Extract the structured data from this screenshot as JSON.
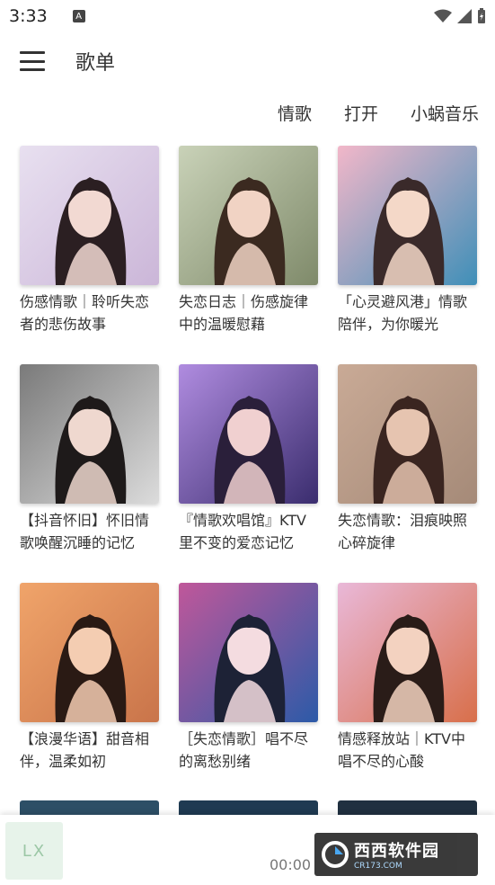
{
  "status_bar": {
    "time": "3:33",
    "notification_icon": "a-icon"
  },
  "app_bar": {
    "title": "歌单"
  },
  "tabs": [
    "情歌",
    "打开",
    "小蜗音乐"
  ],
  "playlists": [
    {
      "title": "伤感情歌｜聆听失恋者的悲伤故事",
      "cover": {
        "bg": "#cbb6d8",
        "hair": "#2b1f22",
        "skin": "#f2d9d2",
        "accent": "#e8e0f0"
      }
    },
    {
      "title": "失恋日志｜伤感旋律中的温暖慰藉",
      "cover": {
        "bg": "#7f8a6a",
        "hair": "#3b2a20",
        "skin": "#f1d3c4",
        "accent": "#c9d2b8"
      }
    },
    {
      "title": "「心灵避风港」情歌陪伴，为你暖光",
      "cover": {
        "bg": "#3f8fb8",
        "hair": "#3a2a2a",
        "skin": "#f4d8c8",
        "accent": "#f2b7c9"
      }
    },
    {
      "title": "【抖音怀旧】怀旧情歌唤醒沉睡的记忆",
      "cover": {
        "bg": "#dcdcdc",
        "hair": "#1e1a1a",
        "skin": "#efd8cf",
        "accent": "#7a7a7a"
      }
    },
    {
      "title": "『情歌欢唱馆』KTV里不变的爱恋记忆",
      "cover": {
        "bg": "#3a2d6e",
        "hair": "#2a1f3a",
        "skin": "#f0d0d0",
        "accent": "#b08ce0"
      }
    },
    {
      "title": "失恋情歌：泪痕映照心碎旋律",
      "cover": {
        "bg": "#a58a78",
        "hair": "#3a2520",
        "skin": "#e6c4b0",
        "accent": "#c9aa96"
      }
    },
    {
      "title": "【浪漫华语】甜音相伴，温柔如初",
      "cover": {
        "bg": "#c9744a",
        "hair": "#2a1a14",
        "skin": "#f4cdb2",
        "accent": "#f0a46a"
      }
    },
    {
      "title": "［失恋情歌］唱不尽的离愁别绪",
      "cover": {
        "bg": "#2c5aa8",
        "hair": "#1d2236",
        "skin": "#f4dce0",
        "accent": "#c0579a"
      }
    },
    {
      "title": "情感释放站｜KTV中唱不尽的心酸",
      "cover": {
        "bg": "#d86f4a",
        "hair": "#2a1c18",
        "skin": "#f3d2c0",
        "accent": "#e9b8d8"
      }
    }
  ],
  "partial_covers": [
    {
      "bg": "#2d4f66"
    },
    {
      "bg": "#1f3a52"
    },
    {
      "bg": "#203040"
    }
  ],
  "player": {
    "logo_text": "LX",
    "time": "00:00"
  },
  "watermark": {
    "title": "西西软件园",
    "sub": "CR173.COM"
  }
}
